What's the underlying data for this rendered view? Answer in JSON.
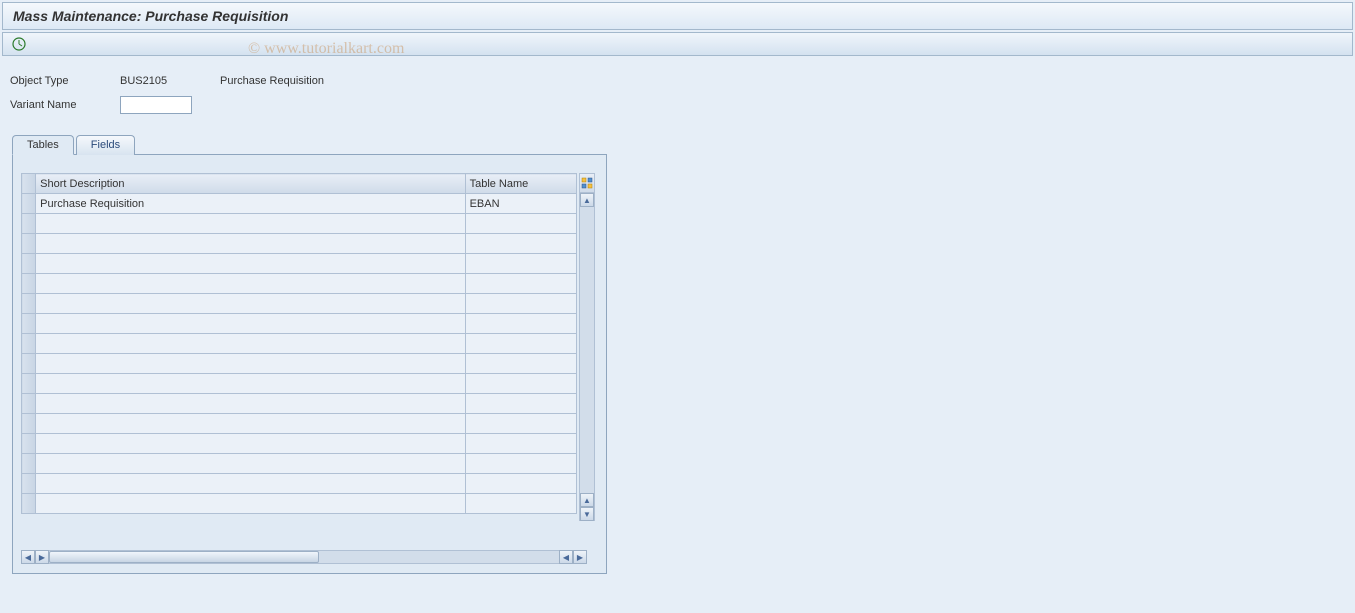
{
  "header": {
    "title": "Mass Maintenance: Purchase Requisition"
  },
  "watermark": "© www.tutorialkart.com",
  "form": {
    "object_type_label": "Object Type",
    "object_type_value": "BUS2105",
    "object_type_desc": "Purchase Requisition",
    "variant_name_label": "Variant Name",
    "variant_name_value": ""
  },
  "tabs": {
    "tables": "Tables",
    "fields": "Fields",
    "active": "tables"
  },
  "grid": {
    "columns": {
      "short_desc": "Short Description",
      "table_name": "Table Name"
    },
    "rows": [
      {
        "short_desc": "Purchase Requisition",
        "table_name": "EBAN"
      },
      {
        "short_desc": "",
        "table_name": ""
      },
      {
        "short_desc": "",
        "table_name": ""
      },
      {
        "short_desc": "",
        "table_name": ""
      },
      {
        "short_desc": "",
        "table_name": ""
      },
      {
        "short_desc": "",
        "table_name": ""
      },
      {
        "short_desc": "",
        "table_name": ""
      },
      {
        "short_desc": "",
        "table_name": ""
      },
      {
        "short_desc": "",
        "table_name": ""
      },
      {
        "short_desc": "",
        "table_name": ""
      },
      {
        "short_desc": "",
        "table_name": ""
      },
      {
        "short_desc": "",
        "table_name": ""
      },
      {
        "short_desc": "",
        "table_name": ""
      },
      {
        "short_desc": "",
        "table_name": ""
      },
      {
        "short_desc": "",
        "table_name": ""
      },
      {
        "short_desc": "",
        "table_name": ""
      }
    ]
  }
}
